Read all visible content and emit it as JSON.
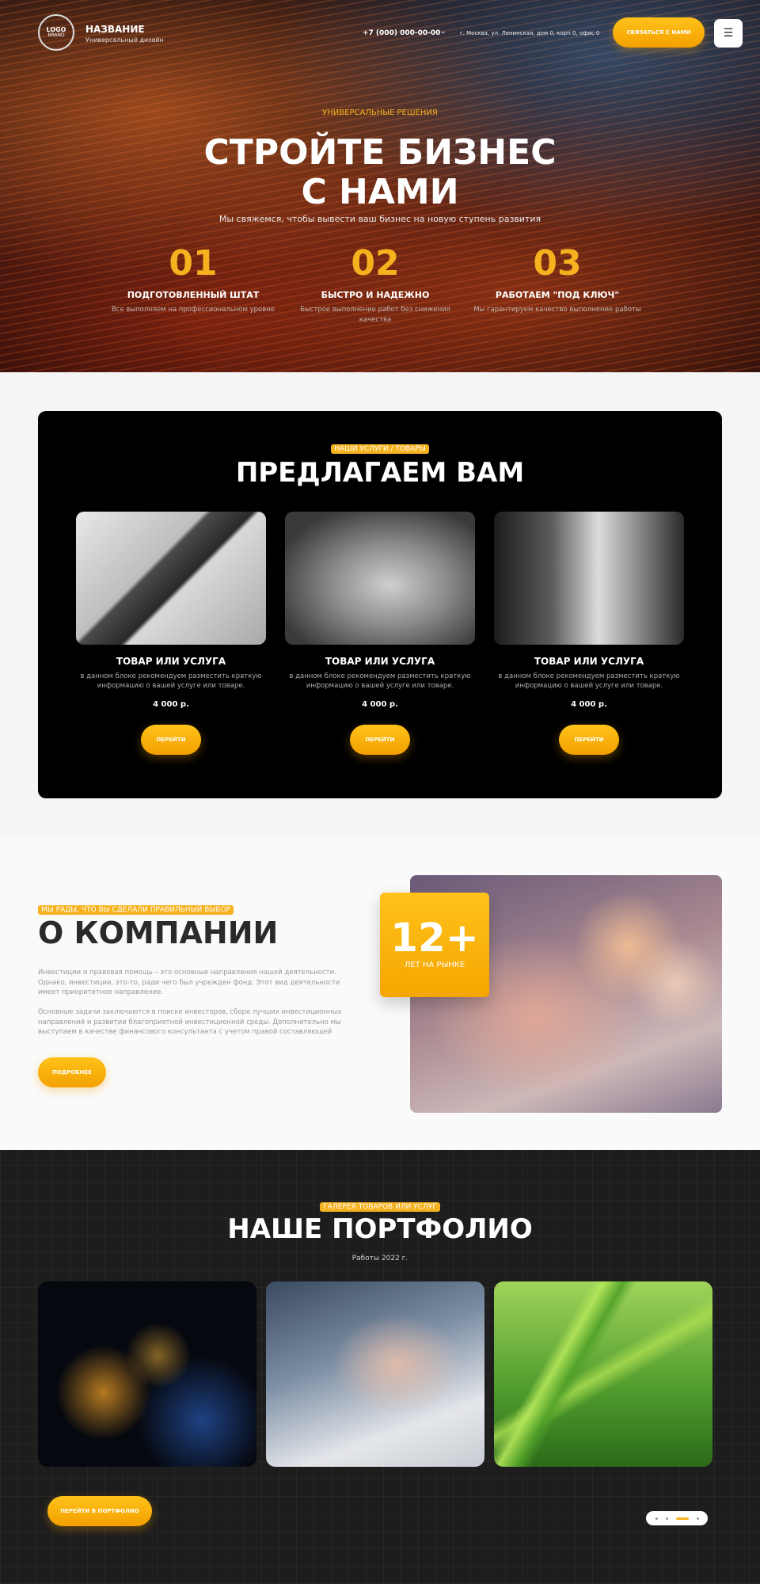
{
  "header": {
    "logo_line1": "LOGO",
    "logo_line2": "BRAND",
    "brand_title": "НАЗВАНИЕ",
    "brand_subtitle": "Универсальный дизайн",
    "phone": "+7 (000) 000-00-00",
    "address": "г. Москва, ул. Ленинская, дом 0, корп 0, офис 0",
    "contact_button": "СВЯЗАТЬСЯ С НАМИ",
    "menu_icon": "hamburger-icon"
  },
  "hero": {
    "eyebrow": "УНИВЕРСАЛЬНЫЕ РЕШЕНИЯ",
    "title_line1": "СТРОЙТЕ БИЗНЕС",
    "title_line2": "С НАМИ",
    "subtitle": "Мы свяжемся, чтобы вывести ваш бизнес на новую ступень развития",
    "stats": [
      {
        "num": "01",
        "label": "ПОДГОТОВЛЕННЫЙ ШТАТ",
        "desc": "Все выполняем на профессиональном уровне"
      },
      {
        "num": "02",
        "label": "БЫСТРО И НАДЕЖНО",
        "desc": "Быстрое выполнение работ без снижения качества"
      },
      {
        "num": "03",
        "label": "РАБОТАЕМ \"ПОД КЛЮЧ\"",
        "desc": "Мы гарантируем качество выполнение работы"
      }
    ]
  },
  "services": {
    "tag": "НАШИ УСЛУГИ / ТОВАРЫ",
    "title": "ПРЕДЛАГАЕМ ВАМ",
    "cards": [
      {
        "title": "ТОВАР ИЛИ УСЛУГА",
        "desc": "в данном блоке рекомендуем разместить краткую информацию о вашей услуге или товаре.",
        "price": "4 000 р.",
        "button": "ПЕРЕЙТИ"
      },
      {
        "title": "ТОВАР ИЛИ УСЛУГА",
        "desc": "в данном блоке рекомендуем разместить краткую информацию о вашей услуге или товаре.",
        "price": "4 000 р.",
        "button": "ПЕРЕЙТИ"
      },
      {
        "title": "ТОВАР ИЛИ УСЛУГА",
        "desc": "в данном блоке рекомендуем разместить краткую информацию о вашей услуге или товаре.",
        "price": "4 000 р.",
        "button": "ПЕРЕЙТИ"
      }
    ]
  },
  "about": {
    "tag": "МЫ РАДЫ, ЧТО ВЫ СДЕЛАЛИ ПРАВИЛЬНЫЙ ВЫБОР",
    "title": "О КОМПАНИИ",
    "paragraph1": "Инвестиции и правовая помощь – это основные направления нашей деятельности. Однако, инвестиции, это-то, ради чего был учрежден фонд. Этот вид деятельности имеет приоритетное направление.",
    "paragraph2": "Основные задачи заключаются в поиске инвесторов, сборе лучших инвестиционных направлений и развитии благоприятной инвестиционной среды. Дополнительно мы выступаем в качестве финансового консультанта с учетом правой составляющей",
    "button": "ПОДРОБНЕЕ",
    "badge_number": "12+",
    "badge_label": "ЛЕТ НА РЫНКЕ"
  },
  "portfolio": {
    "tag": "ГАЛЕРЕЯ ТОВАРОВ ИЛИ УСЛУГ",
    "title": "НАШЕ ПОРТФОЛИО",
    "subtitle": "Работы 2022 г.",
    "button": "ПЕРЕЙТИ В ПОРТФОЛИО"
  }
}
